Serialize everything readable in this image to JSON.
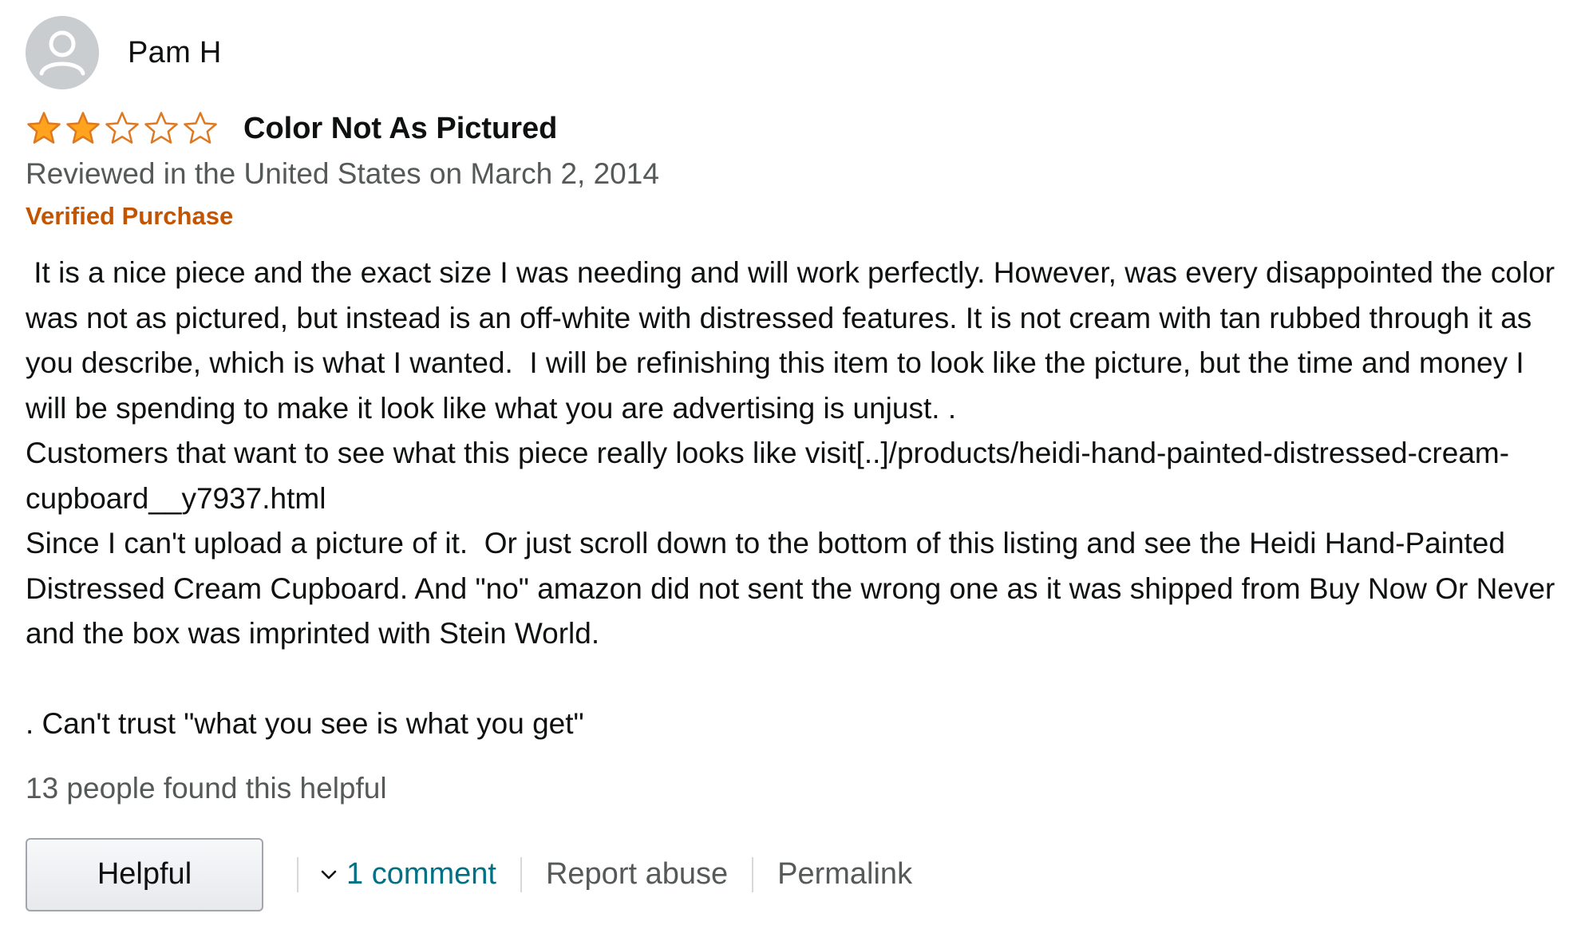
{
  "review": {
    "profile_name": "Pam H",
    "avatar_icon": "default-user-avatar-icon",
    "rating": 2,
    "max_rating": 5,
    "star_color": "#ffa41c",
    "star_outline_color": "#de7921",
    "title": "Color Not As Pictured",
    "date_line": "Reviewed in the United States on March 2, 2014",
    "verified_label": "Verified Purchase",
    "verified_color": "#c45500",
    "body": " It is a nice piece and the exact size I was needing and will work perfectly. However, was every disappointed the color was not as pictured, but instead is an off-white with distressed features. It is not cream with tan rubbed through it as you describe, which is what I wanted.  I will be refinishing this item to look like the picture, but the time and money I will be spending to make it look like what you are advertising is unjust. .\nCustomers that want to see what this piece really looks like visit[..]/products/heidi-hand-painted-distressed-cream-cupboard__y7937.html\nSince I can't upload a picture of it.  Or just scroll down to the bottom of this listing and see the Heidi Hand-Painted Distressed Cream Cupboard. And \"no\" amazon did not sent the wrong one as it was shipped from Buy Now Or Never and the box was imprinted with Stein World.\n\n. Can't trust \"what you see is what you get\"",
    "helpful_count_text": "13 people found this helpful"
  },
  "actions": {
    "helpful_button_label": "Helpful",
    "comment_link_label": "1 comment",
    "comment_icon": "chevron-down-icon",
    "report_abuse_label": "Report abuse",
    "permalink_label": "Permalink",
    "link_color": "#007185"
  }
}
